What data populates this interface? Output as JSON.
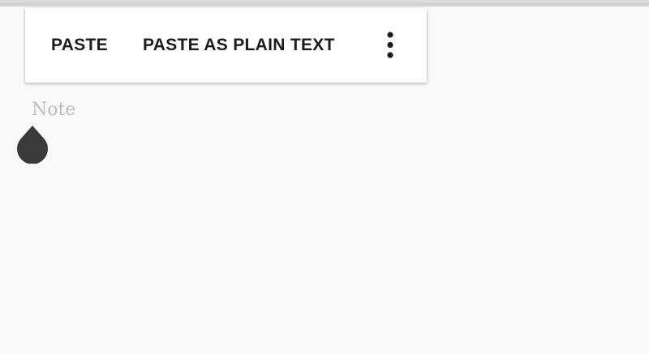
{
  "text_toolbar": {
    "paste_label": "PASTE",
    "paste_plain_label": "PASTE AS PLAIN TEXT",
    "overflow_icon": "more-vert-icon"
  },
  "note": {
    "placeholder": "Note",
    "value": ""
  },
  "selection_handle": {
    "icon": "text-cursor-handle-icon",
    "color": "#3a3a3a"
  },
  "colors": {
    "background": "#f9f9f9",
    "toolbar_background": "#ffffff",
    "toolbar_text": "#1c1c1c",
    "placeholder_text": "#bdbdbd"
  }
}
